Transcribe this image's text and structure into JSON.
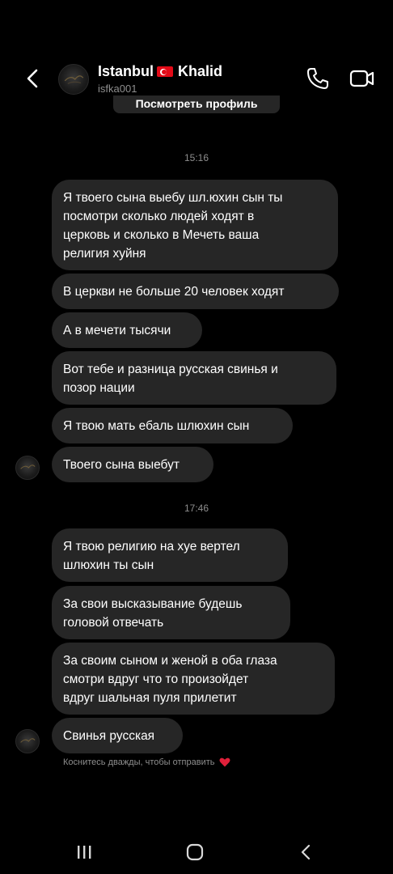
{
  "header": {
    "name_part1": "Istanbul",
    "name_part2": "Khalid",
    "username": "isfka001",
    "flag_icon": "turkey-flag-icon",
    "icons": [
      "back-arrow-icon",
      "phone-icon",
      "video-camera-icon"
    ]
  },
  "profile_button": {
    "label": "Посмотреть профиль"
  },
  "timestamps": [
    "15:16",
    "17:46"
  ],
  "messages": [
    {
      "lines": [
        "Я твоего сына выебу шл.юхин сын ты",
        "посмотри сколько людей ходят в",
        "церковь и сколько в Мечеть ваша",
        "религия хуйня"
      ]
    },
    {
      "lines": [
        "В церкви не больше 20 человек ходят"
      ]
    },
    {
      "lines": [
        "А в мечети тысячи"
      ]
    },
    {
      "lines": [
        "Вот тебе и разница русская свинья и",
        "позор нации"
      ]
    },
    {
      "lines": [
        "Я твою мать ебаль шлюхин сын"
      ]
    },
    {
      "lines": [
        "Твоего сына выебут"
      ]
    },
    {
      "lines": [
        "Я твою религию на хуе вертел",
        "шлюхин ты сын"
      ]
    },
    {
      "lines": [
        "За свои высказывание будешь",
        "головой отвечать"
      ]
    },
    {
      "lines": [
        "За своим сыном и женой в оба глаза",
        "смотри вдруг что то произойдет",
        "вдруг шальная пуля прилетит"
      ]
    },
    {
      "lines": [
        "Свинья русская"
      ]
    }
  ],
  "hint": {
    "text": "Коснитесь дважды, чтобы отправить",
    "icon": "heart-icon",
    "icon_color": "#e0203a"
  },
  "colors": {
    "background": "#000000",
    "bubble": "#262626",
    "secondary_text": "#8e8e8e"
  },
  "navbar": {
    "icons": [
      "recent-apps-icon",
      "home-icon",
      "system-back-icon"
    ]
  }
}
